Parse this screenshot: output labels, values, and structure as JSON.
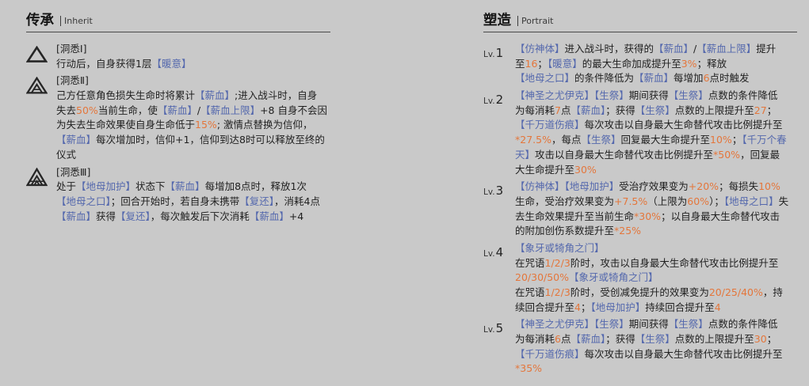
{
  "colors": {
    "background": "#c9c9c9",
    "text": "#1f1f1f",
    "keyword": "#5468ad",
    "number": "#e4763b",
    "rule": "#4a4a4a"
  },
  "inherit": {
    "title": "传承",
    "subtitle": "Inherit",
    "items": [
      {
        "icon": "triangle-icon",
        "name": "[洞悉Ⅰ]",
        "lines": [
          [
            {
              "t": "行动后，自身获得1层"
            },
            {
              "k": "【暖意】"
            }
          ]
        ]
      },
      {
        "icon": "triangle-double-icon",
        "name": "[洞悉Ⅱ]",
        "lines": [
          [
            {
              "t": "己方任意角色损失生命时将累计"
            },
            {
              "k": "【薪血】"
            },
            {
              "t": ";进入战斗时，自身"
            }
          ],
          [
            {
              "t": "失去"
            },
            {
              "n": "50%"
            },
            {
              "t": "当前生命，使"
            },
            {
              "k": "【薪血】"
            },
            {
              "t": "/"
            },
            {
              "k": "【薪血上限】"
            },
            {
              "t": "+8 自身不会因"
            }
          ],
          [
            {
              "t": "为失去生命效果使自身生命低于"
            },
            {
              "n": "15%"
            },
            {
              "t": "; 激情点替换为信仰，"
            }
          ],
          [
            {
              "k": "【薪血】"
            },
            {
              "t": "每次增加时，信仰+1，信仰到达8时可以释放至终的"
            }
          ],
          [
            {
              "t": "仪式"
            }
          ]
        ]
      },
      {
        "icon": "triangle-triple-icon",
        "name": "[洞悉Ⅲ]",
        "lines": [
          [
            {
              "t": "处于"
            },
            {
              "k": "【地母加护】"
            },
            {
              "t": "状态下"
            },
            {
              "k": "【薪血】"
            },
            {
              "t": "每增加8点时，释放1次"
            }
          ],
          [
            {
              "k": "【地母之口】"
            },
            {
              "t": "；回合开始时，若自身未携带"
            },
            {
              "k": "【复还】"
            },
            {
              "t": "，消耗4点"
            }
          ],
          [
            {
              "k": "【薪血】"
            },
            {
              "t": "获得"
            },
            {
              "k": "【复还】"
            },
            {
              "t": "，每次触发后下次消耗"
            },
            {
              "k": "【薪血】"
            },
            {
              "t": "+4"
            }
          ]
        ]
      }
    ]
  },
  "portrait": {
    "title": "塑造",
    "subtitle": "Portrait",
    "levels": [
      {
        "prefix": "Lv.",
        "num": "1",
        "lines": [
          [
            {
              "k": "【仿神体】"
            },
            {
              "t": "进入战斗时，获得的"
            },
            {
              "k": "【薪血】"
            },
            {
              "t": "/"
            },
            {
              "k": "【薪血上限】"
            },
            {
              "t": "提升"
            }
          ],
          [
            {
              "t": "至"
            },
            {
              "n": "16"
            },
            {
              "t": "；"
            },
            {
              "k": "【暖意】"
            },
            {
              "t": "的最大生命加成提升至"
            },
            {
              "n": "3%"
            },
            {
              "t": "；释放"
            }
          ],
          [
            {
              "k": "【地母之口】"
            },
            {
              "t": "的条件降低为"
            },
            {
              "k": "【薪血】"
            },
            {
              "t": "每增加"
            },
            {
              "n": "6"
            },
            {
              "t": "点时触发"
            }
          ]
        ]
      },
      {
        "prefix": "Lv.",
        "num": "2",
        "lines": [
          [
            {
              "k": "【神圣之尤伊克】"
            },
            {
              "k": "【生祭】"
            },
            {
              "t": "期间获得"
            },
            {
              "k": "【生祭】"
            },
            {
              "t": "点数的条件降低"
            }
          ],
          [
            {
              "t": "为每消耗"
            },
            {
              "n": "7"
            },
            {
              "t": "点"
            },
            {
              "k": "【薪血】"
            },
            {
              "t": "；获得"
            },
            {
              "k": "【生祭】"
            },
            {
              "t": "点数的上限提升至"
            },
            {
              "n": "27"
            },
            {
              "t": "；"
            }
          ],
          [
            {
              "k": "【千万道伤痕】"
            },
            {
              "t": "每次攻击以自身最大生命替代攻击比例提升至"
            }
          ],
          [
            {
              "n": "*27.5%"
            },
            {
              "t": "，每点"
            },
            {
              "k": "【生祭】"
            },
            {
              "t": "回复最大生命提升至"
            },
            {
              "n": "10%"
            },
            {
              "t": "；"
            },
            {
              "k": "【千万个春"
            }
          ],
          [
            {
              "k": "天】"
            },
            {
              "t": "攻击以自身最大生命替代攻击比例提升至"
            },
            {
              "n": "*50%"
            },
            {
              "t": "，回复最"
            }
          ],
          [
            {
              "t": "大生命提升至"
            },
            {
              "n": "30%"
            }
          ]
        ]
      },
      {
        "prefix": "Lv.",
        "num": "3",
        "lines": [
          [
            {
              "k": "【仿神体】"
            },
            {
              "k": "【地母加护】"
            },
            {
              "t": "受治疗效果变为"
            },
            {
              "n": "+20%"
            },
            {
              "t": "；每损失"
            },
            {
              "n": "10%"
            }
          ],
          [
            {
              "t": "生命，受治疗效果变为"
            },
            {
              "n": "+7.5%"
            },
            {
              "t": "（上限为"
            },
            {
              "n": "60%"
            },
            {
              "t": "）；"
            },
            {
              "k": "【地母之口】"
            },
            {
              "t": "失"
            }
          ],
          [
            {
              "t": "去生命效果提升至当前生命"
            },
            {
              "n": "*30%"
            },
            {
              "t": "；以自身最大生命替代攻击"
            }
          ],
          [
            {
              "t": "的附加创伤系数提升至"
            },
            {
              "n": "*25%"
            }
          ]
        ]
      },
      {
        "prefix": "Lv.",
        "num": "4",
        "lines": [
          [
            {
              "k": "【象牙或犄角之门】"
            }
          ],
          [
            {
              "t": "在咒语"
            },
            {
              "n": "1/2/3"
            },
            {
              "t": "阶时，攻击以自身最大生命替代攻击比例提升至"
            }
          ],
          [
            {
              "n": "20/30/50%"
            },
            {
              "k": "【象牙或犄角之门】"
            }
          ],
          [
            {
              "t": "在咒语"
            },
            {
              "n": "1/2/3"
            },
            {
              "t": "阶时，受创减免提升的效果变为"
            },
            {
              "n": "20/25/40%"
            },
            {
              "t": "，持"
            }
          ],
          [
            {
              "t": "续回合提升至"
            },
            {
              "n": "4"
            },
            {
              "t": "；"
            },
            {
              "k": "【地母加护】"
            },
            {
              "t": "持续回合提升至"
            },
            {
              "n": "4"
            }
          ]
        ]
      },
      {
        "prefix": "Lv.",
        "num": "5",
        "lines": [
          [
            {
              "k": "【神圣之尤伊克】"
            },
            {
              "k": "【生祭】"
            },
            {
              "t": "期间获得"
            },
            {
              "k": "【生祭】"
            },
            {
              "t": "点数的条件降低"
            }
          ],
          [
            {
              "t": "为每消耗"
            },
            {
              "n": "6"
            },
            {
              "t": "点"
            },
            {
              "k": "【薪血】"
            },
            {
              "t": "；获得"
            },
            {
              "k": "【生祭】"
            },
            {
              "t": "点数的上限提升至"
            },
            {
              "n": "30"
            },
            {
              "t": "；"
            }
          ],
          [
            {
              "k": "【千万道伤痕】"
            },
            {
              "t": "每次攻击以自身最大生命替代攻击比例提升至"
            }
          ],
          [
            {
              "n": "*35%"
            }
          ]
        ]
      }
    ]
  }
}
